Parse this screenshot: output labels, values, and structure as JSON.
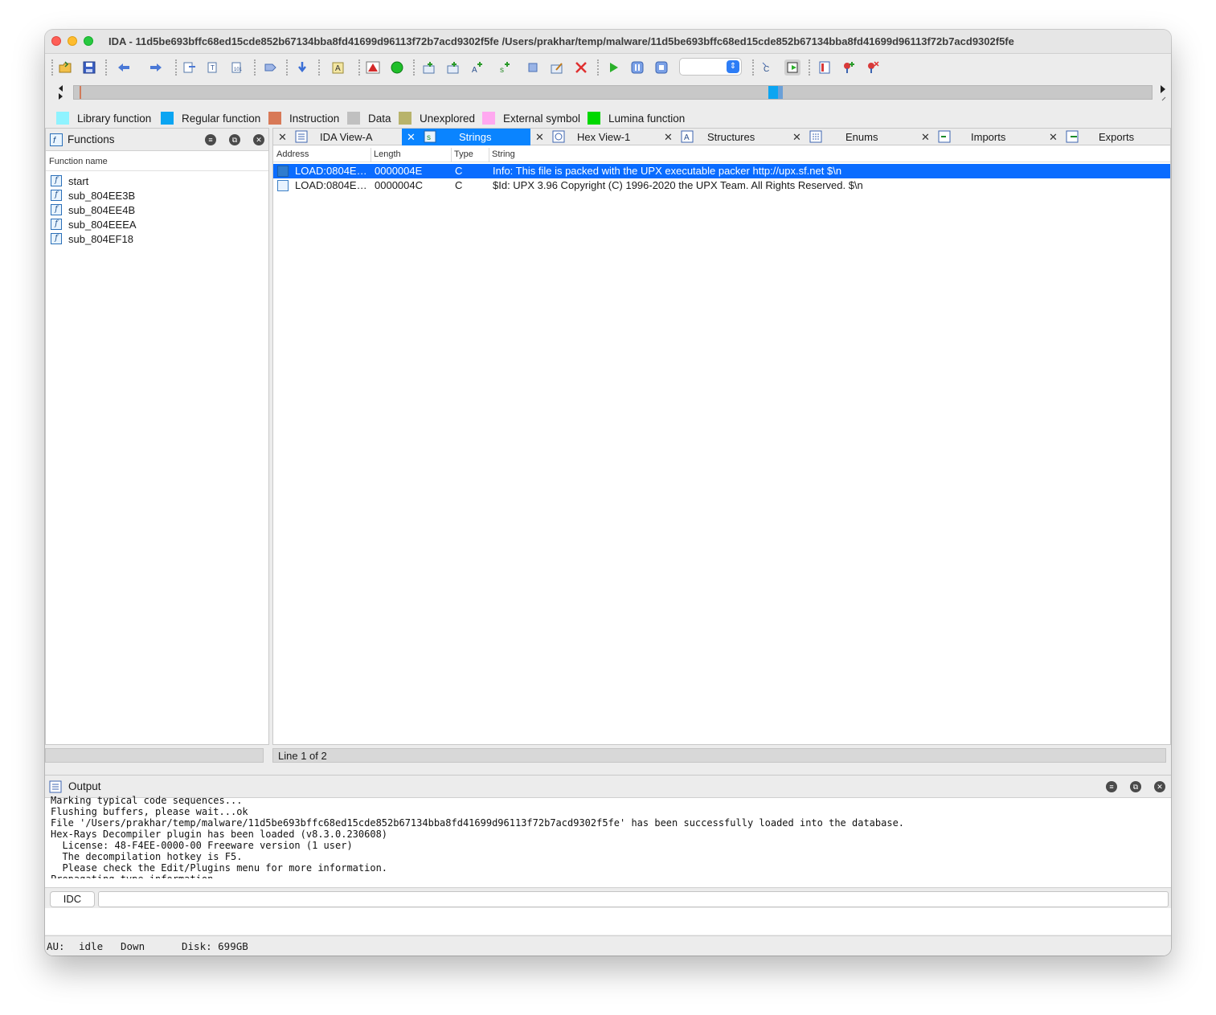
{
  "window": {
    "title": "IDA - 11d5be693bffc68ed15cde852b67134bba8fd41699d96113f72b7acd9302f5fe /Users/prakhar/temp/malware/11d5be693bffc68ed15cde852b67134bba8fd41699d96113f72b7acd9302f5fe"
  },
  "legend": [
    {
      "label": "Library function",
      "color": "#8ff3ff"
    },
    {
      "label": "Regular function",
      "color": "#0ba5f2"
    },
    {
      "label": "Instruction",
      "color": "#d87957"
    },
    {
      "label": "Data",
      "color": "#c0c0c0"
    },
    {
      "label": "Unexplored",
      "color": "#b8b36b"
    },
    {
      "label": "External symbol",
      "color": "#ffa8f0"
    },
    {
      "label": "Lumina function",
      "color": "#00d800"
    }
  ],
  "functions_panel": {
    "title": "Functions",
    "column": "Function name",
    "items": [
      "start",
      "sub_804EE3B",
      "sub_804EE4B",
      "sub_804EEEA",
      "sub_804EF18"
    ]
  },
  "tabs": [
    {
      "label": "IDA View-A",
      "icon": "disassembly-icon"
    },
    {
      "label": "Strings",
      "icon": "strings-icon"
    },
    {
      "label": "Hex View-1",
      "icon": "hex-icon"
    },
    {
      "label": "Structures",
      "icon": "structures-icon"
    },
    {
      "label": "Enums",
      "icon": "enums-icon"
    },
    {
      "label": "Imports",
      "icon": "imports-icon"
    },
    {
      "label": "Exports",
      "icon": "exports-icon"
    }
  ],
  "strings_view": {
    "columns": [
      "Address",
      "Length",
      "Type",
      "String"
    ],
    "rows": [
      {
        "address": "LOAD:0804E…",
        "length": "0000004E",
        "type": "C",
        "string": "Info: This file is packed with the UPX executable packer http://upx.sf.net $\\n"
      },
      {
        "address": "LOAD:0804E…",
        "length": "0000004C",
        "type": "C",
        "string": "$Id: UPX 3.96 Copyright (C) 1996-2020 the UPX Team. All Rights Reserved. $\\n"
      }
    ],
    "status": "Line 1 of 2"
  },
  "output": {
    "title": "Output",
    "lines": "Marking typical code sequences...\nFlushing buffers, please wait...ok\nFile '/Users/prakhar/temp/malware/11d5be693bffc68ed15cde852b67134bba8fd41699d96113f72b7acd9302f5fe' has been successfully loaded into the database.\nHex-Rays Decompiler plugin has been loaded (v8.3.0.230608)\n  License: 48-F4EE-0000-00 Freeware version (1 user)\n  The decompilation hotkey is F5.\n  Please check the Edit/Plugins menu for more information.\nPropagating type information...\nFunction argument information has been propagated\nThe initial autoanalysis has been finished.",
    "idc_label": "IDC"
  },
  "statusbar": {
    "au_label": "AU:",
    "au_state": "idle",
    "scroll": "Down",
    "disk": "Disk: 699GB"
  }
}
